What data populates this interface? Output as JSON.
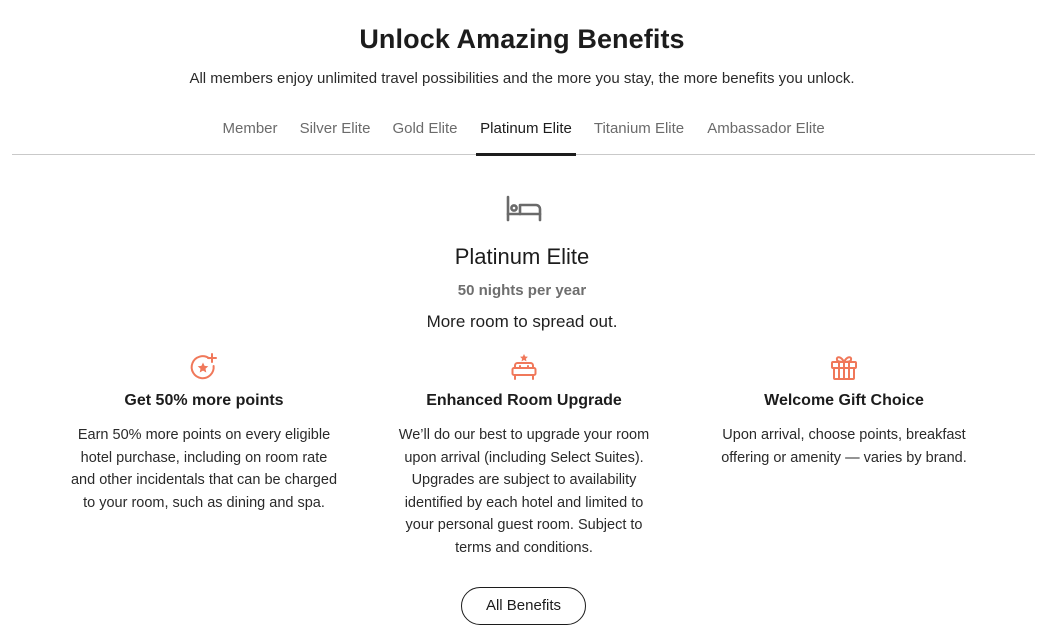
{
  "header": {
    "title": "Unlock Amazing Benefits",
    "subtitle": "All members enjoy unlimited travel possibilities and the more you stay, the more benefits you unlock."
  },
  "tabs": [
    {
      "label": "Member",
      "active": false
    },
    {
      "label": "Silver Elite",
      "active": false
    },
    {
      "label": "Gold Elite",
      "active": false
    },
    {
      "label": "Platinum Elite",
      "active": true
    },
    {
      "label": "Titanium Elite",
      "active": false
    },
    {
      "label": "Ambassador Elite",
      "active": false
    }
  ],
  "tier": {
    "icon": "bed-icon",
    "name": "Platinum Elite",
    "nights": "50 nights per year",
    "tagline": "More room to spread out."
  },
  "benefits": [
    {
      "icon": "star-sparkle-icon",
      "title": "Get 50% more points",
      "description": "Earn 50% more points on every eligible hotel purchase, including on room rate and other incidentals that can be charged to your room, such as dining and spa."
    },
    {
      "icon": "room-upgrade-icon",
      "title": "Enhanced Room Upgrade",
      "description": "We’ll do our best to upgrade your room upon arrival (including Select Suites). Upgrades are subject to availability identified by each hotel and limited to your personal guest room. Subject to terms and conditions."
    },
    {
      "icon": "gift-icon",
      "title": "Welcome Gift Choice",
      "description": "Upon arrival, choose points, breakfast offering or amenity — varies by brand."
    }
  ],
  "cta": {
    "label": "All Benefits"
  },
  "colors": {
    "accent": "#f0785a",
    "text": "#1c1c1c",
    "muted": "#6b6b6b",
    "divider": "#c9c9c9"
  }
}
